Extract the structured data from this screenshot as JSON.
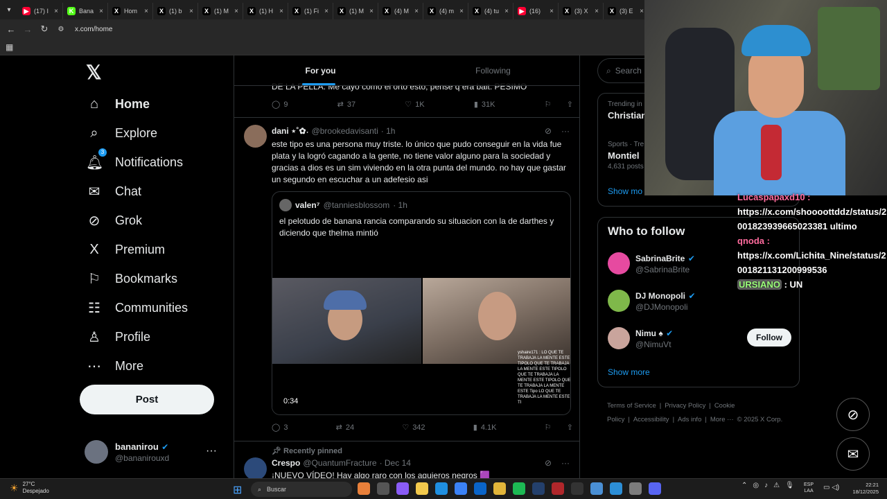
{
  "browser": {
    "tabs": [
      {
        "label": "(17) I",
        "fav": "▶",
        "color": "#ff0033"
      },
      {
        "label": "Bana",
        "fav": "K",
        "color": "#53fc18"
      },
      {
        "label": "Hom",
        "fav": "X",
        "color": "#000"
      },
      {
        "label": "(1) b",
        "fav": "X",
        "color": "#000"
      },
      {
        "label": "(1) M",
        "fav": "X",
        "color": "#000"
      },
      {
        "label": "(1) H",
        "fav": "X",
        "color": "#000"
      },
      {
        "label": "(1) Fi",
        "fav": "X",
        "color": "#000"
      },
      {
        "label": "(1) M",
        "fav": "X",
        "color": "#000"
      },
      {
        "label": "(4) M",
        "fav": "X",
        "color": "#000"
      },
      {
        "label": "(4) m",
        "fav": "X",
        "color": "#000"
      },
      {
        "label": "(4) tu",
        "fav": "X",
        "color": "#000"
      },
      {
        "label": "(16)",
        "fav": "▶",
        "color": "#ff0033"
      },
      {
        "label": "(3) X",
        "fav": "X",
        "color": "#000"
      },
      {
        "label": "(3) E",
        "fav": "X",
        "color": "#000"
      }
    ],
    "url": "x.com/home"
  },
  "sidebar": {
    "items": [
      {
        "label": "Home",
        "icon": "⌂"
      },
      {
        "label": "Explore",
        "icon": "⌕"
      },
      {
        "label": "Notifications",
        "icon": "🔔︎",
        "badge": "3"
      },
      {
        "label": "Chat",
        "icon": "✉"
      },
      {
        "label": "Grok",
        "icon": "⊘"
      },
      {
        "label": "Premium",
        "icon": "X"
      },
      {
        "label": "Bookmarks",
        "icon": "⚐"
      },
      {
        "label": "Communities",
        "icon": "☷"
      },
      {
        "label": "Profile",
        "icon": "♙"
      },
      {
        "label": "More",
        "icon": "⋯"
      }
    ],
    "post_label": "Post",
    "account": {
      "name": "bananirou",
      "handle": "@bananirouxd"
    }
  },
  "timeline": {
    "tabs": [
      "For you",
      "Following"
    ],
    "prev_text": "DE LA PELLA. Me cayo como el orto esto, pense q era bait. PESIMO",
    "prev_actions": {
      "replies": "9",
      "reposts": "37",
      "likes": "1K",
      "views": "31K"
    },
    "tweet": {
      "name": "dani ⋆˚✿˖",
      "handle": "@brookedavisanti",
      "time": "· 1h",
      "text": "este tipo es una persona muy triste. lo único que pudo conseguir en la vida fue plata y la logró cagando a la gente, no tiene valor alguno para la sociedad y gracias a dios es un sim viviendo en la otra punta del mundo. no hay que gastar un segundo en escuchar a un adefesio asi",
      "quote": {
        "name": "valen⁷",
        "handle": "@tanniesblossom",
        "time": "· 1h",
        "text": "el pelotudo de banana rancia comparando su situacion con la de darthes y diciendo que thelma mintió",
        "video_chat": "yshaire171 : LO QUE TE TRABAJA LA MENTE ESTE TIPOLO QUE TE TRABAJA LA MENTE ESTE TIPOLO QUE TE TRABAJA LA MENTE ESTE TIPOLO QUE TE TRABAJA LA MENTE ESTE Tipo LO QUE TE TRABAJA LA MENTE ESTE TI",
        "duration": "0:34"
      },
      "actions": {
        "replies": "3",
        "reposts": "24",
        "likes": "342",
        "views": "4.1K"
      }
    },
    "pinned_label": "Recently pinned",
    "next": {
      "name": "Crespo",
      "handle": "@QuantumFracture",
      "time": "· Dec 14",
      "text": "¡NUEVO VÍDEO! Hay algo raro con los agujeros negros 🟪"
    }
  },
  "right": {
    "search_placeholder": "Search",
    "trends": [
      {
        "cat": "Trending in",
        "title": "Christian",
        "count": ""
      },
      {
        "cat": "Sports · Tre",
        "title": "Montiel",
        "count": "4,631 posts"
      }
    ],
    "show_more": "Show mo",
    "who_to_follow": "Who to follow",
    "suggestions": [
      {
        "name": "SabrinaBrite",
        "handle": "@SabrinaBrite",
        "color": "#e64aa0"
      },
      {
        "name": "DJ Monopoli",
        "handle": "@DJMonopoli",
        "color": "#7fb84a"
      },
      {
        "name": "Nimu ♠",
        "handle": "@NimuVt",
        "color": "#c9a49c"
      }
    ],
    "follow_label": "Follow",
    "show_more_2": "Show more",
    "footer": [
      "Terms of Service",
      "|",
      "Privacy Policy",
      "|",
      "Cookie Policy",
      "|",
      "Accessibility",
      "|",
      "Ads info",
      "|",
      "More ···",
      "© 2025 X Corp."
    ]
  },
  "overlay_chat": {
    "line0": "Lucaspapaxd10 :",
    "line1": "https://x.com/shoooottddz/status/2001823939665023381 ultimo",
    "user2": "qnoda :",
    "line2": "https://x.com/Lichita_Nine/status/2001821131200999536",
    "user3": "URSIANO",
    "msg3": ": UN"
  },
  "taskbar": {
    "temp": "27°C",
    "weather": "Despejado",
    "search": "Buscar",
    "lang1": "ESP",
    "lang2": "LAA",
    "time": "22:21",
    "date": "18/12/2025"
  }
}
